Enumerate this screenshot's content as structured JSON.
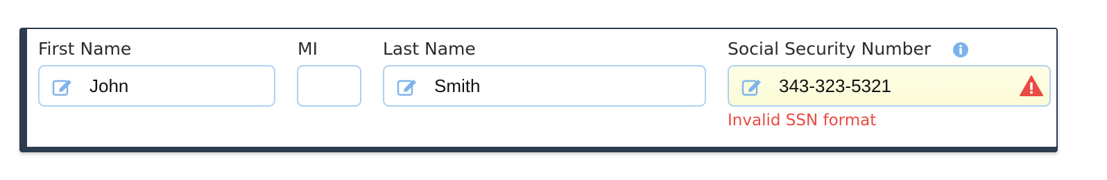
{
  "form": {
    "first_name": {
      "label": "First Name",
      "value": "John",
      "icon": "edit-icon"
    },
    "middle_initial": {
      "label": "MI",
      "value": ""
    },
    "last_name": {
      "label": "Last Name",
      "value": "Smith",
      "icon": "edit-icon"
    },
    "ssn": {
      "label": "Social Security Number",
      "value": "343-323-5321",
      "icon": "edit-icon",
      "info_icon": "info-icon",
      "status_icon": "warning-icon",
      "error": "Invalid SSN format"
    }
  },
  "colors": {
    "panel_border": "#2d3c4f",
    "field_border": "#aed1f2",
    "icon_blue": "#7db3ea",
    "error_red": "#ea4a44",
    "invalid_bg": "#fcfcd8"
  }
}
